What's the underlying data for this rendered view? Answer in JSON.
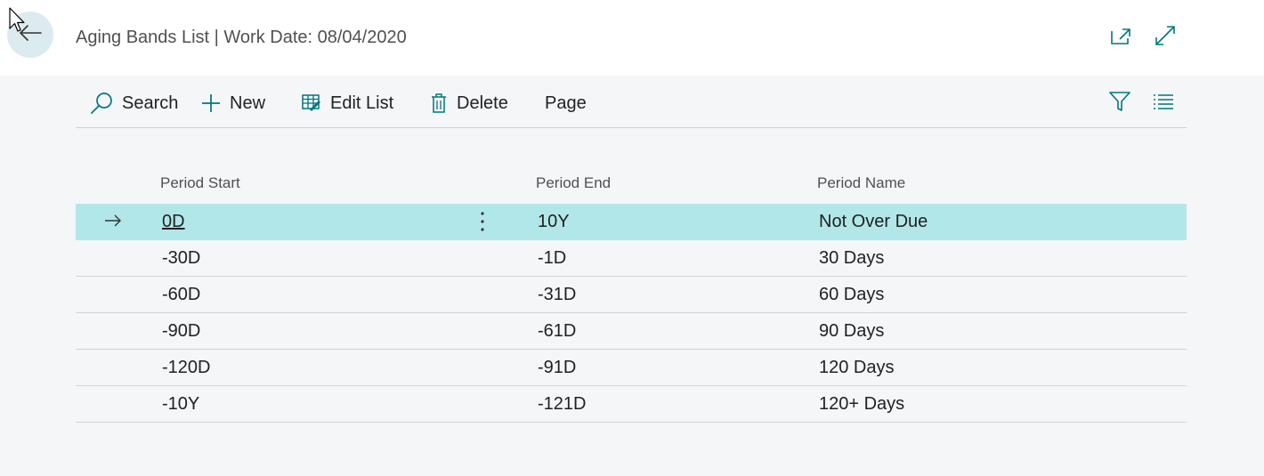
{
  "header": {
    "title": "Aging Bands List | Work Date: 08/04/2020",
    "back_icon": "arrow-left-icon",
    "open_new_window_icon": "open-in-new-window-icon",
    "expand_icon": "expand-icon"
  },
  "actions": {
    "search": "Search",
    "new": "New",
    "edit_list": "Edit List",
    "delete": "Delete",
    "page": "Page"
  },
  "columns": {
    "period_start": "Period Start",
    "period_end": "Period End",
    "period_name": "Period Name"
  },
  "rows": [
    {
      "start": "0D",
      "end": "10Y",
      "name": "Not Over Due",
      "selected": true
    },
    {
      "start": "-30D",
      "end": "-1D",
      "name": "30 Days"
    },
    {
      "start": "-60D",
      "end": "-31D",
      "name": "60 Days"
    },
    {
      "start": "-90D",
      "end": "-61D",
      "name": "90 Days"
    },
    {
      "start": "-120D",
      "end": "-91D",
      "name": "120 Days"
    },
    {
      "start": "-10Y",
      "end": "-121D",
      "name": "120+ Days"
    }
  ],
  "colors": {
    "accent": "#00767e",
    "selected_row": "#b2e7ea",
    "back_button_bg": "#dcebf0"
  }
}
